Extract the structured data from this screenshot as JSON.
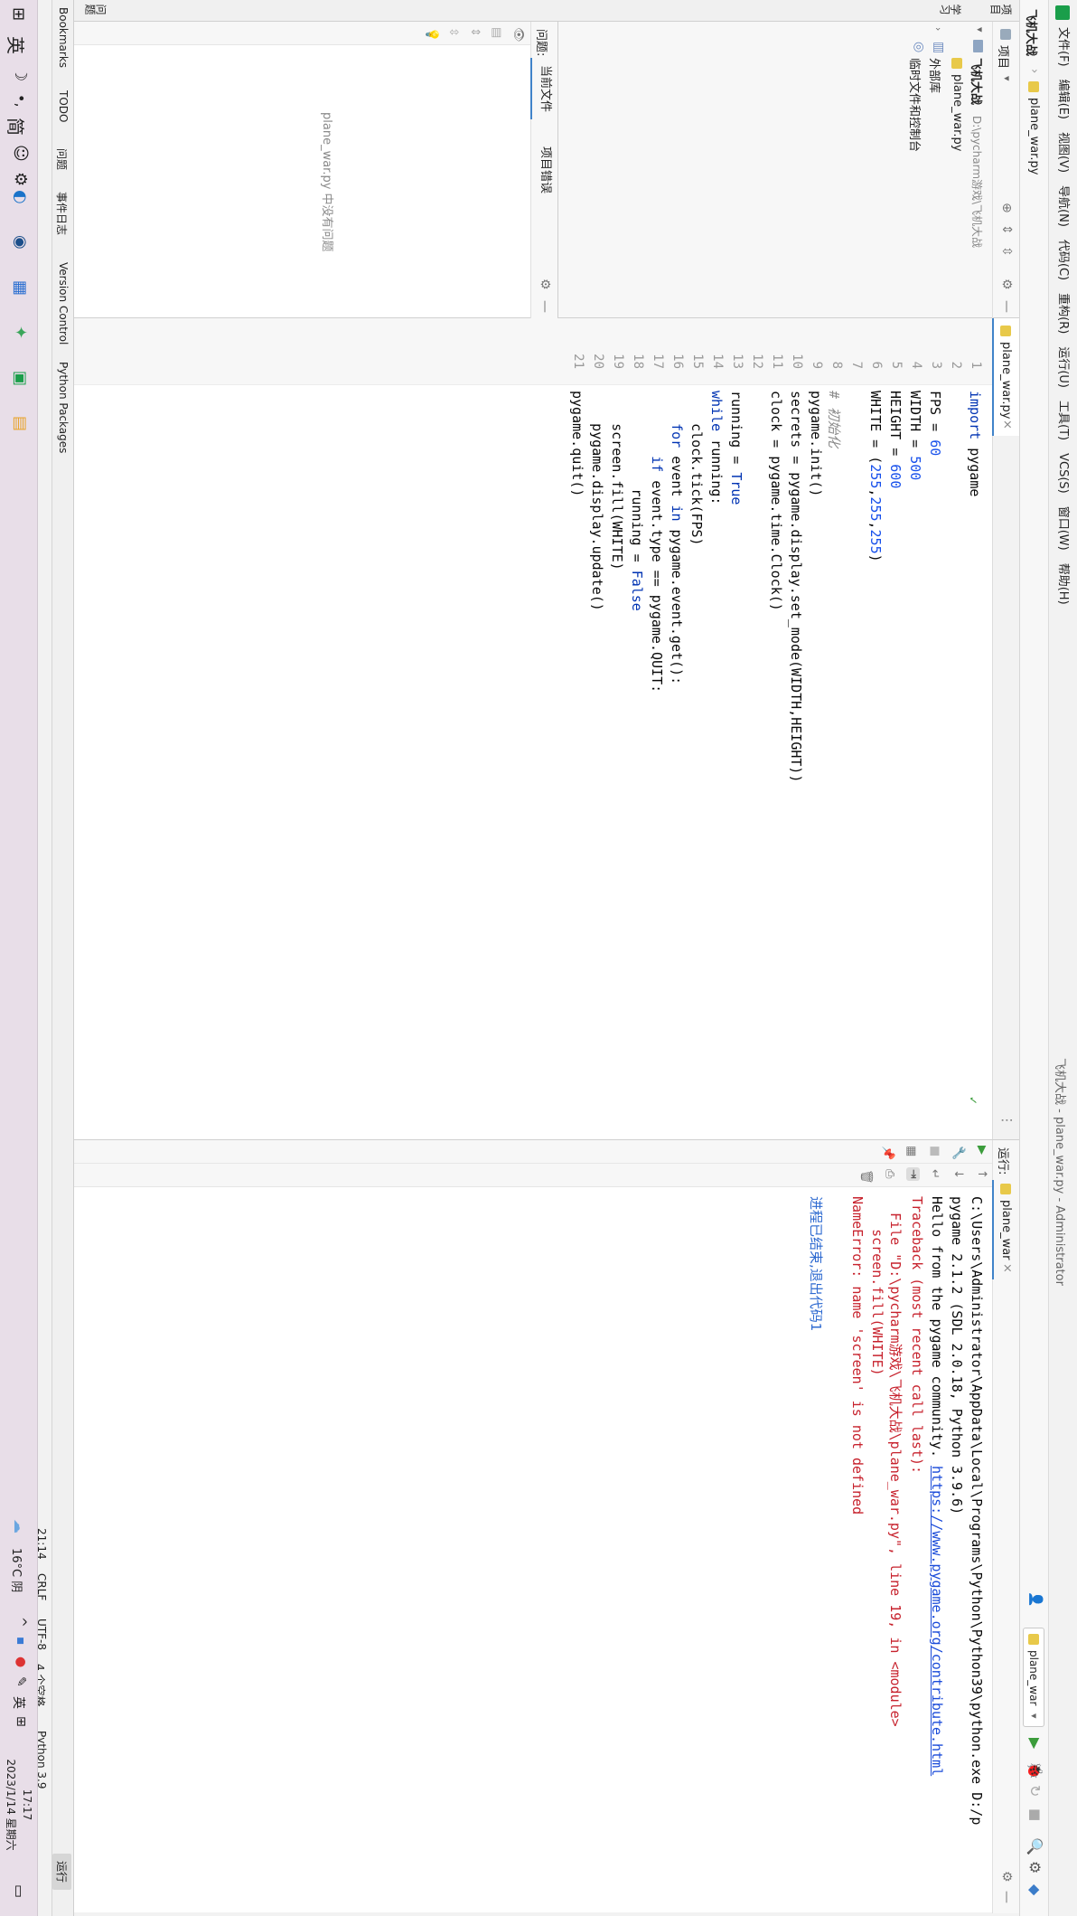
{
  "window": {
    "title": "飞机大战 - plane_war.py - Administrator"
  },
  "menu": [
    "文件(F)",
    "编辑(E)",
    "视图(V)",
    "导航(N)",
    "代码(C)",
    "重构(R)",
    "运行(U)",
    "工具(T)",
    "VCS(S)",
    "窗口(W)",
    "帮助(H)"
  ],
  "breadcrumb": {
    "project": "飞机大战",
    "file": "plane_war.py"
  },
  "navbar_right": {
    "run_config": "plane_war"
  },
  "project_panel": {
    "title": "项目",
    "root_name": "飞机大战",
    "root_path": "D:\\pycharm游戏\\飞机大战",
    "items": [
      "plane_war.py",
      "外部库",
      "临时文件和控制台"
    ]
  },
  "problems_panel": {
    "label": "问题:",
    "tabs": [
      "当前文件",
      "项目错误"
    ],
    "empty_message": "plane_war.py 中没有问题"
  },
  "editor": {
    "tab_name": "plane_war.py",
    "line_numbers": [
      "1",
      "2",
      "3",
      "4",
      "5",
      "6",
      "7",
      "8",
      "9",
      "10",
      "11",
      "12",
      "13",
      "14",
      "15",
      "16",
      "17",
      "18",
      "19",
      "20",
      "21"
    ],
    "lines": [
      "import pygame",
      "",
      "FPS = 60",
      "WIDTH = 500",
      "HEIGHT = 600",
      "WHITE = (255,255,255)",
      "",
      "# 初始化",
      "pygame.init()",
      "secrets = pygame.display.set_mode(WIDTH,HEIGHT))",
      "clock = pygame.time.Clock()",
      "",
      "running = True",
      "while running:",
      "    clock.tick(FPS)",
      "    for event in pygame.event.get():",
      "        if event.type == pygame.QUIT:",
      "            running = False",
      "    screen.fill(WHITE)",
      "    pygame.display.update()",
      "pygame.quit()"
    ]
  },
  "run_panel": {
    "label": "运行:",
    "tab_name": "plane_war",
    "output": [
      "C:\\Users\\Administrator\\AppData\\Local\\Programs\\Python\\Python39\\python.exe D:/p",
      "pygame 2.1.2 (SDL 2.0.18, Python 3.9.6)",
      "Hello from the pygame community. https://www.pygame.org/contribute.html",
      "Traceback (most recent call last):",
      "  File \"D:\\pycharm游戏\\飞机大战\\plane_war.py\", line 19, in <module>",
      "    screen.fill(WHITE)",
      "NameError: name 'screen' is not defined",
      "",
      "进程已结束,退出代码1"
    ]
  },
  "left_strip": {
    "project": "项目",
    "study": "学习",
    "structure": "结构",
    "bookmarks": "Bookmarks"
  },
  "problems_tab_strip": {
    "label": "问题"
  },
  "bottom_tools": [
    "Bookmarks",
    "TODO",
    "问题",
    "事件日志",
    "Version Control",
    "Python Packages"
  ],
  "bottom_run": "运行",
  "status": {
    "position": "21:14",
    "line_sep": "CRLF",
    "encoding": "UTF-8",
    "indent": "4 个空格",
    "interpreter": "Python 3.9"
  },
  "taskbar": {
    "weather": "16°C 阴",
    "time": "17:17",
    "date": "2023/1/14 星期六",
    "ime_lang": "英",
    "ime_mode": "简"
  },
  "colors": {
    "accent": "#4083c9",
    "keyword": "#0033b3",
    "number": "#1750eb",
    "error": "#c7222d"
  }
}
